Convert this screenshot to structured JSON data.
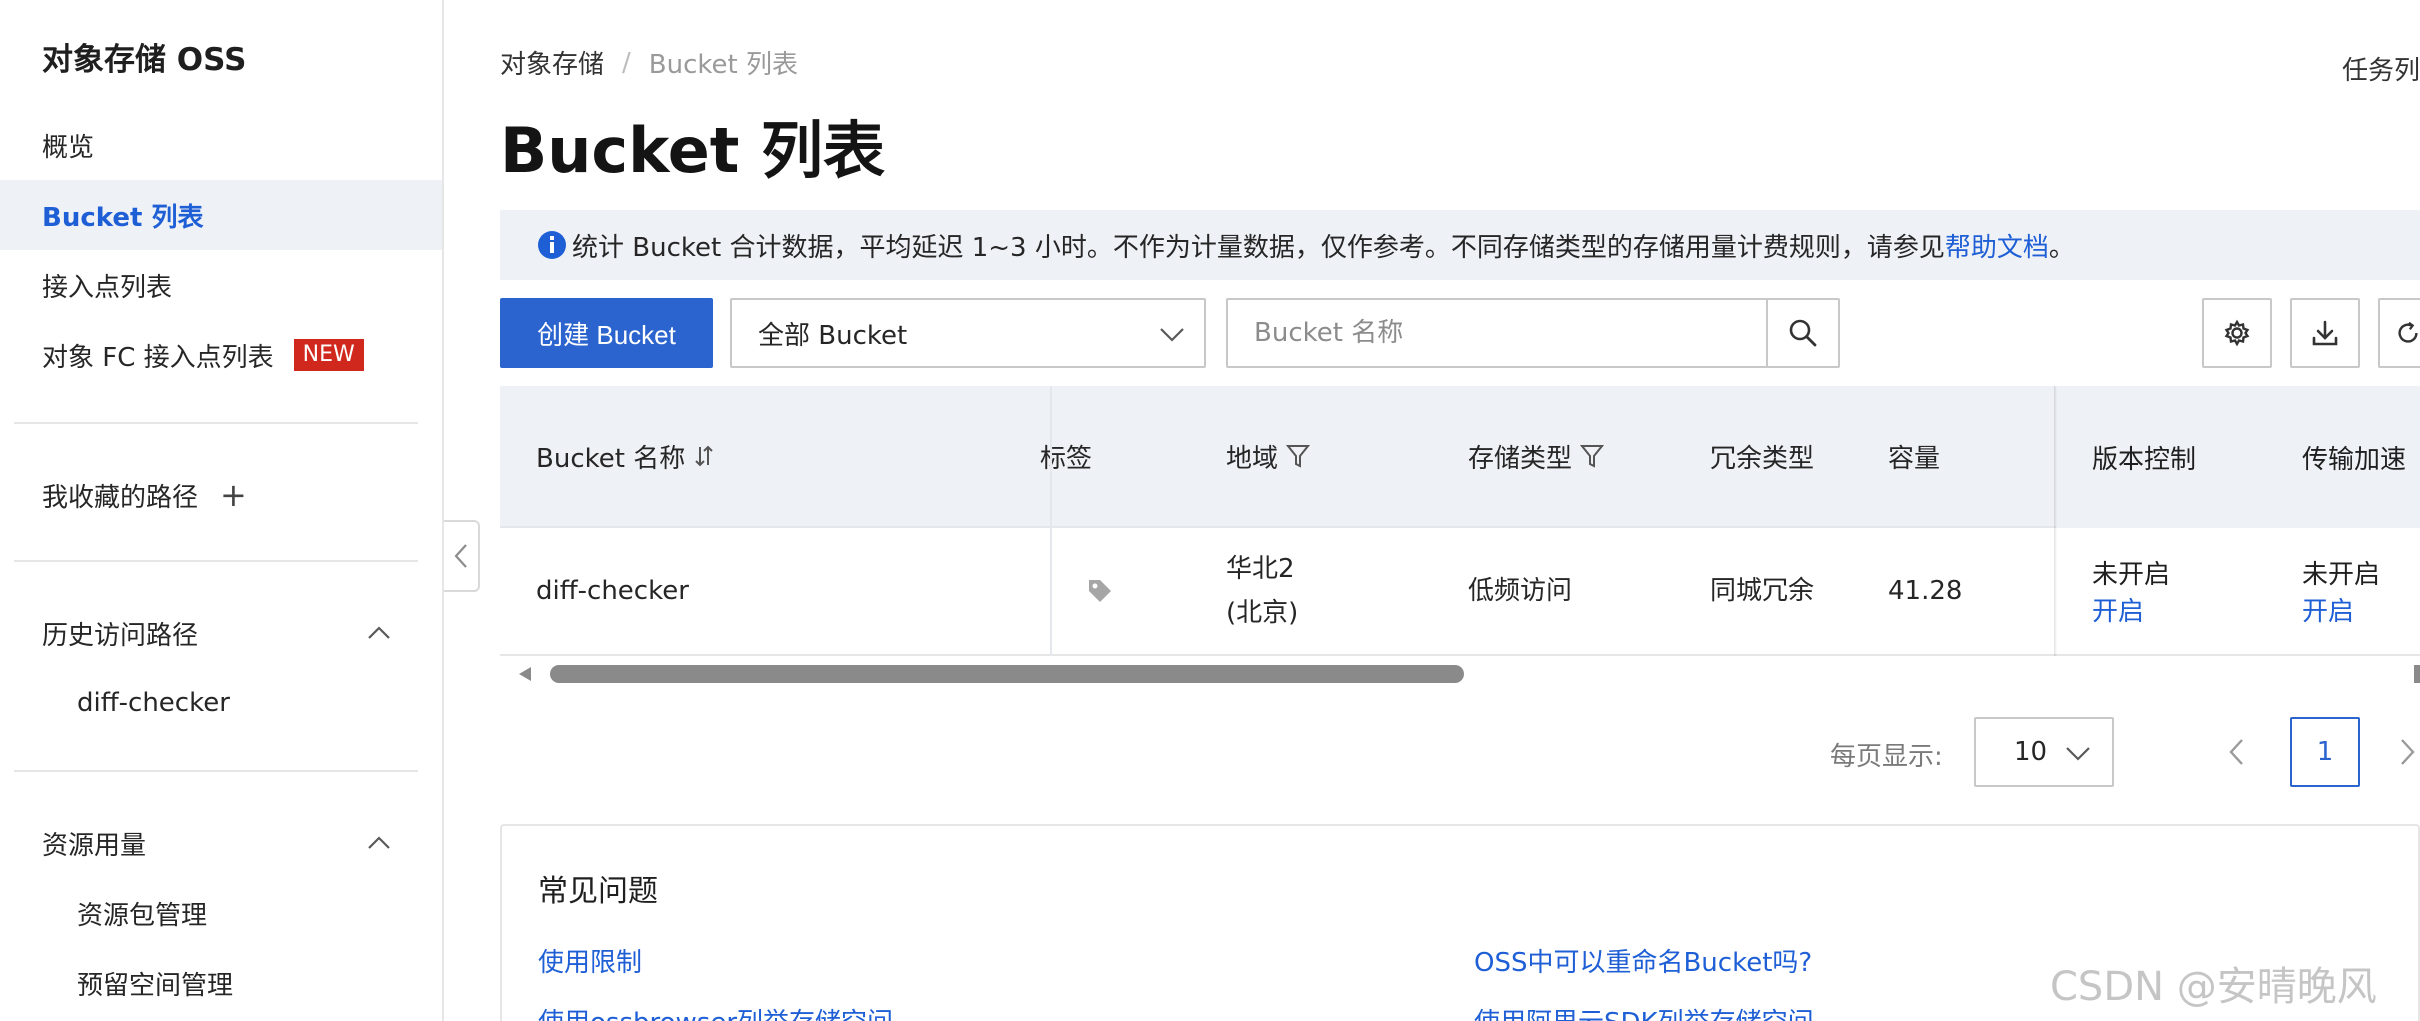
{
  "sidebar": {
    "title": "对象存储 OSS",
    "items": [
      {
        "label": "概览"
      },
      {
        "label": "Bucket 列表"
      },
      {
        "label": "接入点列表"
      },
      {
        "label": "对象 FC 接入点列表",
        "badge": "NEW"
      }
    ],
    "favorites_label": "我收藏的路径",
    "favorites_add": "+",
    "history_label": "历史访问路径",
    "history_items": [
      {
        "label": "diff-checker"
      }
    ],
    "usage_label": "资源用量",
    "usage_items": [
      {
        "label": "资源包管理"
      },
      {
        "label": "预留空间管理"
      }
    ]
  },
  "header": {
    "breadcrumb_root": "对象存储",
    "breadcrumb_sep": "/",
    "breadcrumb_current": "Bucket 列表",
    "task_list": "任务列表",
    "page_title": "Bucket 列表"
  },
  "info": {
    "text": "统计 Bucket 合计数据，平均延迟 1~3 小时。不作为计量数据，仅作参考。不同存储类型的存储用量计费规则，请参见",
    "link": "帮助文档",
    "suffix": "。"
  },
  "toolbar": {
    "create_label": "创建 Bucket",
    "filter_value": "全部 Bucket",
    "search_placeholder": "Bucket 名称"
  },
  "table": {
    "columns": {
      "name": "Bucket 名称",
      "tags": "标签",
      "region": "地域",
      "storage_class": "存储类型",
      "redundancy": "冗余类型",
      "capacity": "容量",
      "versioning": "版本控制",
      "acceleration": "传输加速"
    },
    "rows": [
      {
        "name": "diff-checker",
        "region_line1": "华北2",
        "region_line2": "(北京)",
        "storage_class": "低频访问",
        "redundancy": "同城冗余",
        "capacity": "41.28",
        "versioning_status": "未开启",
        "versioning_action": "开启",
        "acceleration_status": "未开启",
        "acceleration_action": "开启"
      }
    ]
  },
  "pagination": {
    "per_page_label": "每页显示:",
    "per_page_value": "10",
    "current_page": "1"
  },
  "faq": {
    "title": "常见问题",
    "links": [
      {
        "label": "使用限制"
      },
      {
        "label": "OSS中可以重命名Bucket吗?"
      },
      {
        "label": "使用ossbrowser列举存储空间"
      },
      {
        "label": "使用阿里云SDK列举存储空间"
      }
    ]
  },
  "watermark": "CSDN @安晴晚风",
  "colors": {
    "accent": "#2c64cf",
    "link": "#1f5fd6",
    "badge": "#d0281d",
    "header_bg": "#eef1f6"
  }
}
